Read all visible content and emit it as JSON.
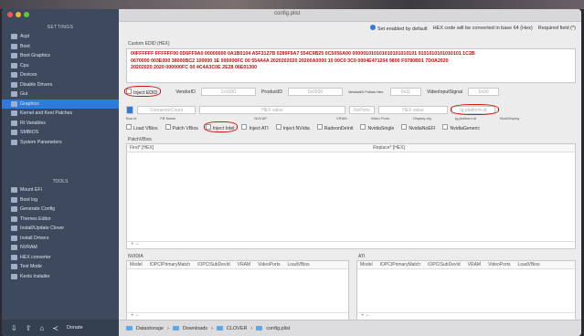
{
  "window": {
    "title": "config.plist"
  },
  "sidebar": {
    "section_settings": "SETTINGS",
    "items": [
      {
        "label": "Acpi"
      },
      {
        "label": "Boot"
      },
      {
        "label": "Boot Graphics"
      },
      {
        "label": "Cpu"
      },
      {
        "label": "Devices"
      },
      {
        "label": "Disable Drivers"
      },
      {
        "label": "Gui"
      },
      {
        "label": "Graphics"
      },
      {
        "label": "Kernel and Kext Patches"
      },
      {
        "label": "Rt Variables"
      },
      {
        "label": "SMBIOS"
      },
      {
        "label": "System Parameters"
      }
    ],
    "section_tools": "TOOLS",
    "tools": [
      {
        "label": "Mount EFI"
      },
      {
        "label": "Boot log"
      },
      {
        "label": "Generate Config"
      },
      {
        "label": "Themes Editor"
      },
      {
        "label": "Install/Update Clover"
      },
      {
        "label": "Install Drivers"
      },
      {
        "label": "NVRAM"
      },
      {
        "label": "HEX converter"
      },
      {
        "label": "Text Mode"
      },
      {
        "label": "Kexts Installer"
      }
    ],
    "donate": "Donate"
  },
  "header": {
    "default_label": "Set enabled by default",
    "hex_note": "HEX code will be converted in base 64 (Hex)",
    "required": "Required field (*)"
  },
  "custom_edid": {
    "label": "Custom EDID (HEX)",
    "line1": "00FFFFFF FFFFFF00 0D6FF9A0 00000000 0A1B0104 A5F3127B 0289F9A7 554C9B25 0C5056A00 000001010101010101010101 0101010101010101 1C2B",
    "line2": "0670000 003E000 38000BC2 100000 1E 000000FC 00 554A4A 2020202020 20200A0000 10 00C0 3C0 0004E471204 9800 F0780B01 7D0A2020",
    "line3": "20202020 2020 000000FC 00 4C4A3C0E 2E28 06E01300"
  },
  "row1": {
    "inject_edid": "Inject EDID",
    "vendorid": "VendorID",
    "vendorid_ph": "1x1000",
    "productid": "ProductID",
    "productid_ph": "0x0000",
    "ver": "VersionID Follow Hex",
    "ver_ph": "0x11",
    "vss": "VideoInputSignal",
    "vss_ph": "0x00"
  },
  "row2": {
    "bus_ph": "ConnectorCount",
    "hex": "HEX value",
    "ports": "NvPorts",
    "hexv": "HEX value",
    "platform": "ig-platform-id"
  },
  "row2labels": {
    "a": "Bus Id",
    "b": "FB Name",
    "c": "NVCAP",
    "d": "VRAM",
    "e": "Video Ports",
    "f": "Display cfg",
    "g": "ig-platform-id",
    "h": "BootDisplay"
  },
  "checks": [
    {
      "label": "Load VBios"
    },
    {
      "label": "Patch VBios"
    },
    {
      "label": "Inject Intel"
    },
    {
      "label": "Inject ATI"
    },
    {
      "label": "Inject NVidia"
    },
    {
      "label": "RadeonDeInit"
    },
    {
      "label": "NvidiaSingle"
    },
    {
      "label": "NvidiaNoEFI"
    },
    {
      "label": "NvidiaGeneric"
    }
  ],
  "patch_vbios": {
    "label": "PatchVBios",
    "col1": "Find* [HEX]",
    "col2": "Replace* [HEX]"
  },
  "ati": {
    "label": "ATI",
    "cols": [
      "Model",
      "IOPCIPrimaryMatch",
      "IOPCISubDevId",
      "VRAM",
      "VideoPorts",
      "LoadVBios"
    ]
  },
  "nvidia": {
    "label": "NVIDIA",
    "cols": [
      "Model",
      "IOPCIPrimaryMatch",
      "IOPCISubDevId",
      "VRAM",
      "VideoPorts",
      "LoadVBios"
    ]
  },
  "path": {
    "parts": [
      "Datastorage",
      "Downloads",
      "CLOVER",
      "config.plist"
    ]
  },
  "colors": {
    "sidebar": "#3d4a5e",
    "selected": "#2f7bdc",
    "mark": "#d01818"
  }
}
